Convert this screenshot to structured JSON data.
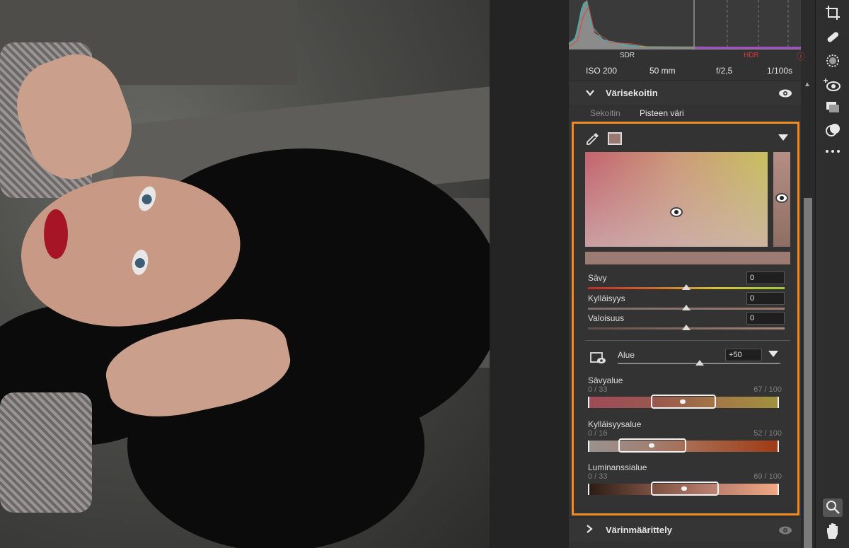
{
  "histogram": {
    "sdr_label": "SDR",
    "hdr_label": "HDR",
    "warning_symbol": "ⓘ"
  },
  "camera_info": {
    "iso": "ISO 200",
    "focal_length": "50 mm",
    "aperture": "f/2,5",
    "shutter": "1/100s"
  },
  "color_mixer": {
    "title": "Värisekoitin",
    "tabs": [
      {
        "label": "Sekoitin",
        "active": false
      },
      {
        "label": "Pisteen väri",
        "active": true
      }
    ],
    "swatch_color": "#9a7a70",
    "sliders": [
      {
        "label": "Sävy",
        "value": "0"
      },
      {
        "label": "Kylläisyys",
        "value": "0"
      },
      {
        "label": "Valoisuus",
        "value": "0"
      }
    ],
    "range": {
      "label": "Alue",
      "value": "+50"
    },
    "range_blocks": [
      {
        "title": "Sävyalue",
        "min": "0 / 33",
        "max": "67 / 100"
      },
      {
        "title": "Kylläisyysalue",
        "min": "0 / 16",
        "max": "52 / 100"
      },
      {
        "title": "Luminanssialue",
        "min": "0 / 33",
        "max": "69 / 100"
      }
    ]
  },
  "next_section": {
    "title": "Värinmäärittely"
  },
  "tools": [
    "crop-icon",
    "healing-icon",
    "masking-icon",
    "red-eye-icon",
    "presets-icon",
    "snapshots-icon",
    "more-icon",
    "zoom-icon",
    "hand-icon"
  ],
  "accent_color": "#f08a22"
}
